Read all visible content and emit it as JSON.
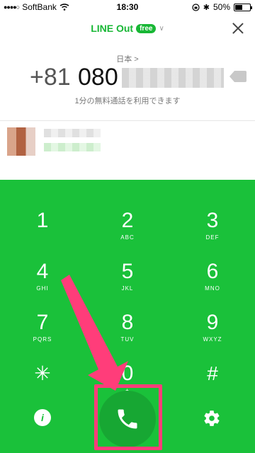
{
  "status_bar": {
    "carrier": "SoftBank",
    "time": "18:30",
    "battery": "50%",
    "battery_level": 0.5
  },
  "header": {
    "brand": "LINE Out",
    "badge": "free"
  },
  "dialer": {
    "country": "日本 >",
    "country_code": "+81",
    "number_prefix": "080",
    "free_note": "1分の無料通話を利用できます"
  },
  "keys": [
    {
      "digit": "1",
      "letters": ""
    },
    {
      "digit": "2",
      "letters": "ABC"
    },
    {
      "digit": "3",
      "letters": "DEF"
    },
    {
      "digit": "4",
      "letters": "GHI"
    },
    {
      "digit": "5",
      "letters": "JKL"
    },
    {
      "digit": "6",
      "letters": "MNO"
    },
    {
      "digit": "7",
      "letters": "PQRS"
    },
    {
      "digit": "8",
      "letters": "TUV"
    },
    {
      "digit": "9",
      "letters": "WXYZ"
    },
    {
      "digit": "✳",
      "letters": ""
    },
    {
      "digit": "0",
      "letters": "+"
    },
    {
      "digit": "#",
      "letters": ""
    }
  ],
  "controls": {
    "info_label": "i"
  },
  "colors": {
    "brand_green": "#18b735",
    "keypad_green": "#1ac13a",
    "call_button": "#17a733",
    "annotation": "#ff3d7a"
  }
}
